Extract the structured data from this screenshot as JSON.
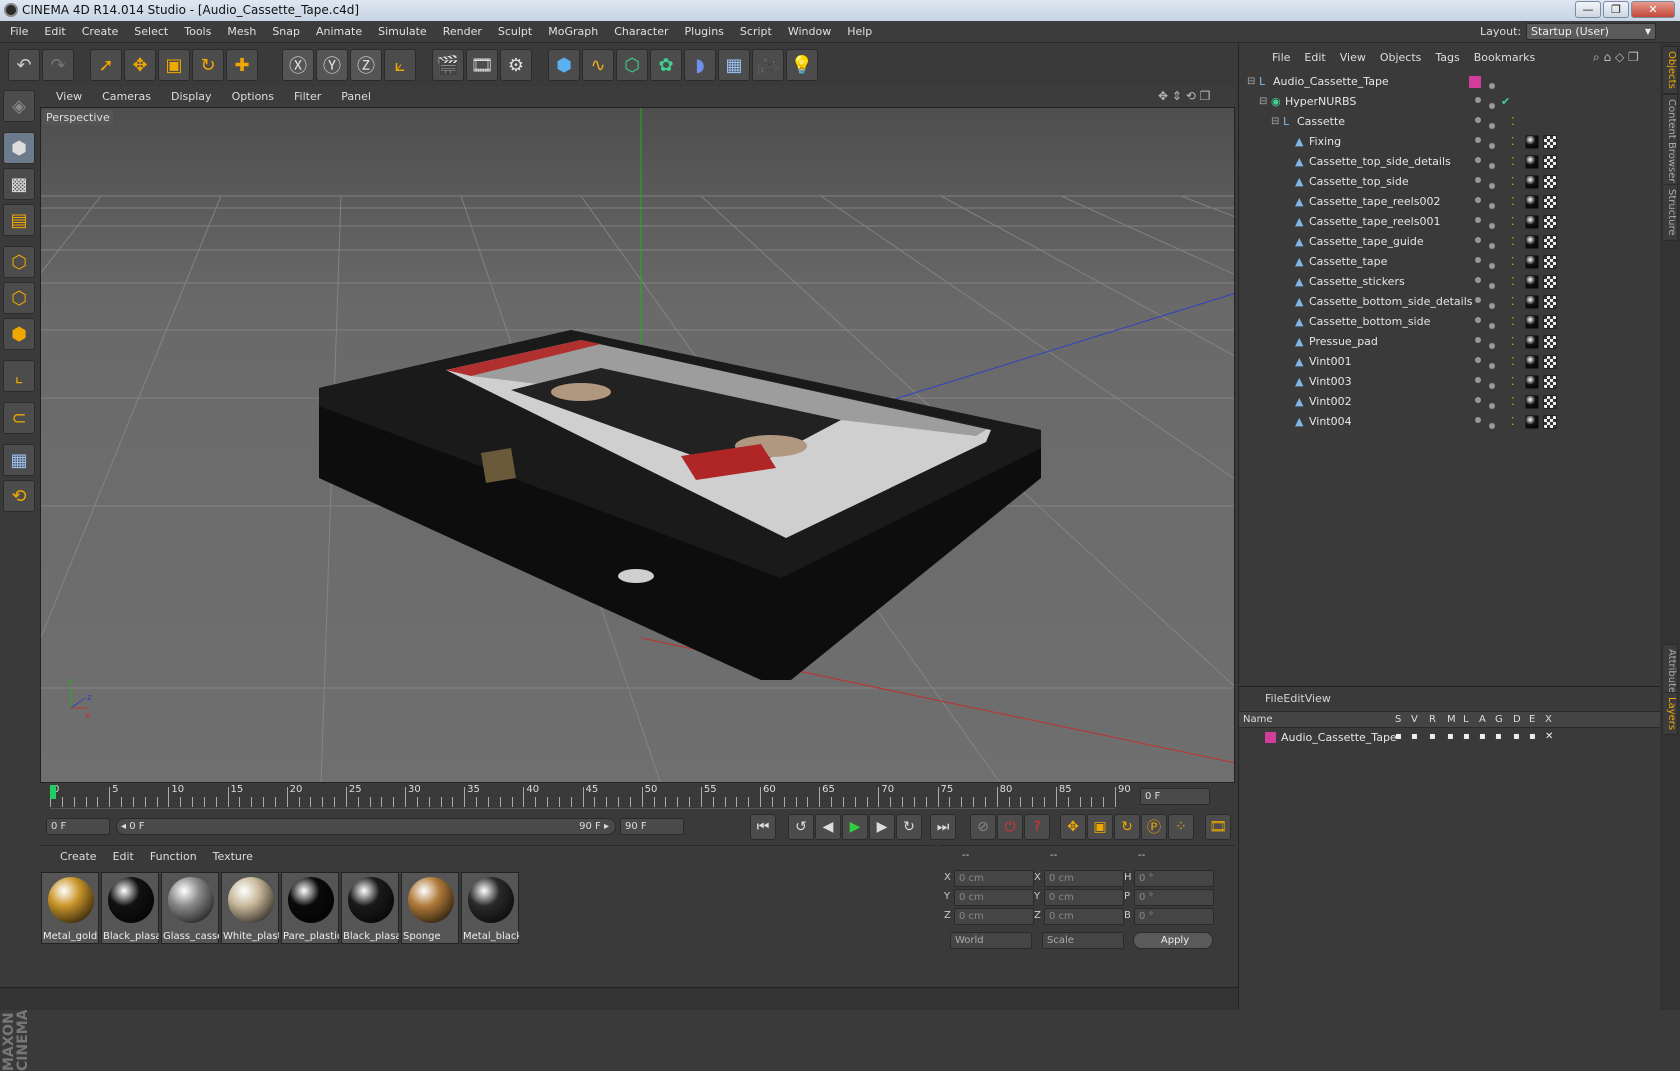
{
  "window": {
    "title": "CINEMA 4D R14.014 Studio - [Audio_Cassette_Tape.c4d]",
    "min": "—",
    "max": "❐",
    "close": "✕"
  },
  "menu": [
    "File",
    "Edit",
    "Create",
    "Select",
    "Tools",
    "Mesh",
    "Snap",
    "Animate",
    "Simulate",
    "Render",
    "Sculpt",
    "MoGraph",
    "Character",
    "Plugins",
    "Script",
    "Window",
    "Help"
  ],
  "layout": {
    "label": "Layout:",
    "value": "Startup (User)"
  },
  "viewport": {
    "menu": [
      "View",
      "Cameras",
      "Display",
      "Options",
      "Filter",
      "Panel"
    ],
    "label": "Perspective"
  },
  "timeline": {
    "ticks": [
      "0",
      "5",
      "10",
      "15",
      "20",
      "25",
      "30",
      "35",
      "40",
      "45",
      "50",
      "55",
      "60",
      "65",
      "70",
      "75",
      "80",
      "85",
      "90"
    ],
    "current_frame": "0 F"
  },
  "transport": {
    "start": "0 F",
    "slider_start": "◂ 0 F",
    "slider_end": "90 F ▸",
    "end": "90 F"
  },
  "materials": {
    "menu": [
      "Create",
      "Edit",
      "Function",
      "Texture"
    ],
    "items": [
      {
        "name": "Metal_gold",
        "color": "#c9952a"
      },
      {
        "name": "Black_plasa",
        "color": "#111111"
      },
      {
        "name": "Glass_cassette",
        "color": "#8a8a8a"
      },
      {
        "name": "White_plastic",
        "color": "#c8b89a"
      },
      {
        "name": "Pare_plastic",
        "color": "#0a0a0a"
      },
      {
        "name": "Black_plasa",
        "color": "#1a1a1a"
      },
      {
        "name": "Sponge",
        "color": "#b07a3a"
      },
      {
        "name": "Metal_black",
        "color": "#2a2a2a"
      }
    ]
  },
  "coords": {
    "header": [
      "--",
      "--",
      "--"
    ],
    "rows": [
      {
        "a": "X",
        "av": "0 cm",
        "b": "X",
        "bv": "0 cm",
        "c": "H",
        "cv": "0 °"
      },
      {
        "a": "Y",
        "av": "0 cm",
        "b": "Y",
        "bv": "0 cm",
        "c": "P",
        "cv": "0 °"
      },
      {
        "a": "Z",
        "av": "0 cm",
        "b": "Z",
        "bv": "0 cm",
        "c": "B",
        "cv": "0 °"
      }
    ],
    "world": "World",
    "scale": "Scale",
    "apply": "Apply"
  },
  "objects": {
    "menu": [
      "File",
      "Edit",
      "View",
      "Objects",
      "Tags",
      "Bookmarks"
    ],
    "tree": [
      {
        "name": "Audio_Cassette_Tape",
        "level": 0,
        "icon": "null-icon"
      },
      {
        "name": "HyperNURBS",
        "level": 1,
        "icon": "hypernurbs-icon"
      },
      {
        "name": "Cassette",
        "level": 2,
        "icon": "null-icon"
      },
      {
        "name": "Fixing",
        "level": 3,
        "icon": "polygon-icon"
      },
      {
        "name": "Cassette_top_side_details",
        "level": 3,
        "icon": "polygon-icon"
      },
      {
        "name": "Cassette_top_side",
        "level": 3,
        "icon": "polygon-icon"
      },
      {
        "name": "Cassette_tape_reels002",
        "level": 3,
        "icon": "polygon-icon"
      },
      {
        "name": "Cassette_tape_reels001",
        "level": 3,
        "icon": "polygon-icon"
      },
      {
        "name": "Cassette_tape_guide",
        "level": 3,
        "icon": "polygon-icon"
      },
      {
        "name": "Cassette_tape",
        "level": 3,
        "icon": "polygon-icon"
      },
      {
        "name": "Cassette_stickers",
        "level": 3,
        "icon": "polygon-icon"
      },
      {
        "name": "Cassette_bottom_side_details",
        "level": 3,
        "icon": "polygon-icon"
      },
      {
        "name": "Cassette_bottom_side",
        "level": 3,
        "icon": "polygon-icon"
      },
      {
        "name": "Pressue_pad",
        "level": 3,
        "icon": "polygon-icon"
      },
      {
        "name": "Vint001",
        "level": 3,
        "icon": "polygon-icon"
      },
      {
        "name": "Vint003",
        "level": 3,
        "icon": "polygon-icon"
      },
      {
        "name": "Vint002",
        "level": 3,
        "icon": "polygon-icon"
      },
      {
        "name": "Vint004",
        "level": 3,
        "icon": "polygon-icon"
      }
    ]
  },
  "layers": {
    "menu": [
      "File",
      "Edit",
      "View"
    ],
    "columns": [
      "Name",
      "S",
      "V",
      "R",
      "M",
      "L",
      "A",
      "G",
      "D",
      "E",
      "X"
    ],
    "rows": [
      {
        "name": "Audio_Cassette_Tape",
        "color": "#d23c9a"
      }
    ]
  },
  "side_tabs": [
    "Objects",
    "Content Browser",
    "Structure",
    "Attributes",
    "Layers"
  ],
  "branding": {
    "logo_text": "MAXON CINEMA 4D"
  },
  "colors": {
    "accent": "#f0a800",
    "layer_color": "#d23c9a",
    "x_axis": "#c03030",
    "y_axis": "#20b020",
    "z_axis": "#3040c0"
  }
}
